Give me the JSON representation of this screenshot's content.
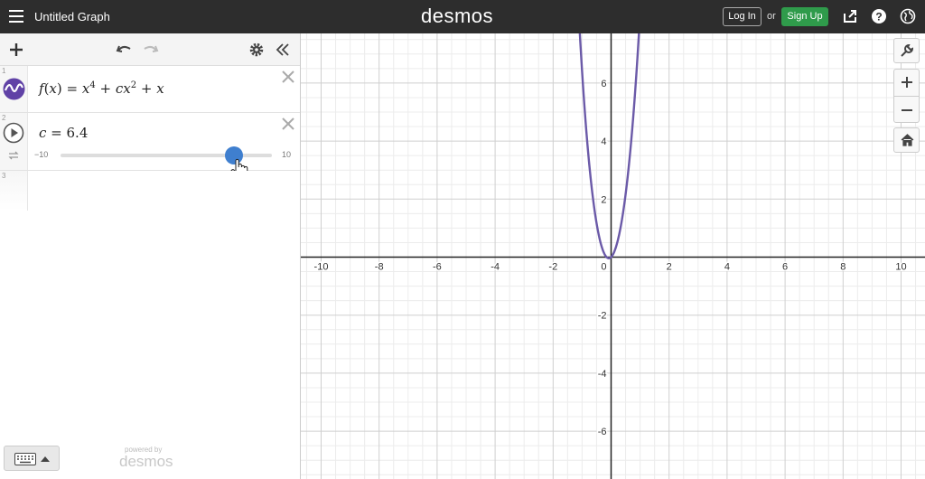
{
  "header": {
    "title": "Untitled Graph",
    "brand": "desmos",
    "login_label": "Log In",
    "or_label": "or",
    "signup_label": "Sign Up"
  },
  "expressions": [
    {
      "number": "1",
      "latex": "f(x) = x^4 + cx^2 + x",
      "color": "#6042a6"
    },
    {
      "number": "2",
      "variable": "c",
      "value": "6.4",
      "slider_min": "−10",
      "slider_max": "10",
      "slider_fraction": 0.82
    },
    {
      "number": "3"
    }
  ],
  "footer": {
    "powered_by": "powered by",
    "logo": "desmos"
  },
  "graph": {
    "x_ticks": [
      "-10",
      "-8",
      "-6",
      "-4",
      "-2",
      "0",
      "2",
      "4",
      "6",
      "8",
      "10"
    ],
    "y_ticks": [
      "6",
      "4",
      "2",
      "-2",
      "-4",
      "-6"
    ],
    "xlim": [
      -10.8,
      10.8
    ],
    "ylim": [
      -7.7,
      7.7
    ],
    "curve_color": "#6b5aa8",
    "c_value": 6.4
  },
  "colors": {
    "header_bg": "#2d2d2d",
    "signup_green": "#2f9b4b",
    "slider_blue": "#3f7fcf"
  },
  "icons": [
    "hamburger-icon",
    "share-icon",
    "help-icon",
    "globe-icon",
    "plus-icon",
    "undo-icon",
    "redo-icon",
    "settings-icon",
    "collapse-icon",
    "function-icon",
    "play-icon",
    "loop-icon",
    "close-icon",
    "keyboard-icon",
    "caret-up-icon",
    "wrench-icon",
    "zoom-in-icon",
    "zoom-out-icon",
    "home-icon"
  ]
}
